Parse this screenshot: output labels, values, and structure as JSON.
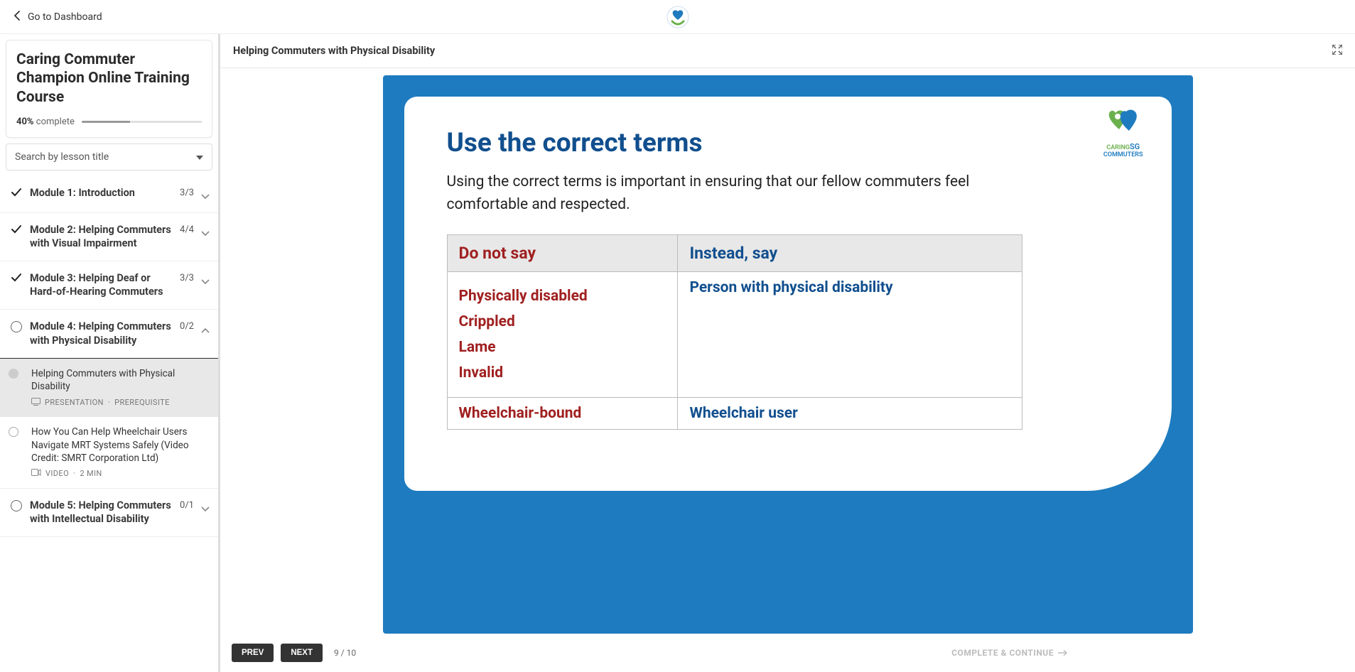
{
  "topbar": {
    "back_label": "Go to Dashboard"
  },
  "course": {
    "title": "Caring Commuter Champion Online Training Course",
    "percent": "40%",
    "complete_word": "complete"
  },
  "search": {
    "placeholder": "Search by lesson title"
  },
  "modules": [
    {
      "title": "Module 1: Introduction",
      "count": "3/3",
      "done": true,
      "expanded": false
    },
    {
      "title": "Module 2: Helping Commuters with Visual Impairment",
      "count": "4/4",
      "done": true,
      "expanded": false
    },
    {
      "title": "Module 3: Helping Deaf or Hard-of-Hearing Commuters",
      "count": "3/3",
      "done": true,
      "expanded": false
    },
    {
      "title": "Module 4: Helping Commuters with Physical Disability",
      "count": "0/2",
      "done": false,
      "expanded": true
    },
    {
      "title": "Module 5: Helping Commuters with Intellectual Disability",
      "count": "0/1",
      "done": false,
      "expanded": false
    }
  ],
  "lessons": [
    {
      "title": "Helping Commuters with Physical Disability",
      "meta_type": "PRESENTATION",
      "meta_extra": "PREREQUISITE",
      "active": true
    },
    {
      "title": "How You Can Help Wheelchair Users Navigate MRT Systems Safely (Video Credit: SMRT Corporation Ltd)",
      "meta_type": "VIDEO",
      "meta_extra": "2 MIN",
      "active": false
    }
  ],
  "content": {
    "header": "Helping Commuters with Physical Disability",
    "slide_title": "Use the correct terms",
    "slide_desc": "Using the correct terms is important in ensuring that our fellow commuters feel comfortable and respected.",
    "th_dont": "Do not say",
    "th_do": "Instead, say",
    "row1_dont": [
      "Physically disabled",
      "Crippled",
      "Lame",
      "Invalid"
    ],
    "row1_do": "Person with physical disability",
    "row2_dont": "Wheelchair-bound",
    "row2_do": "Wheelchair user",
    "logo_line1": "CARING",
    "logo_line2": "SG",
    "logo_line3": "COMMUTERS"
  },
  "footer": {
    "prev": "PREV",
    "next": "NEXT",
    "page": "9 / 10",
    "complete": "COMPLETE & CONTINUE"
  }
}
